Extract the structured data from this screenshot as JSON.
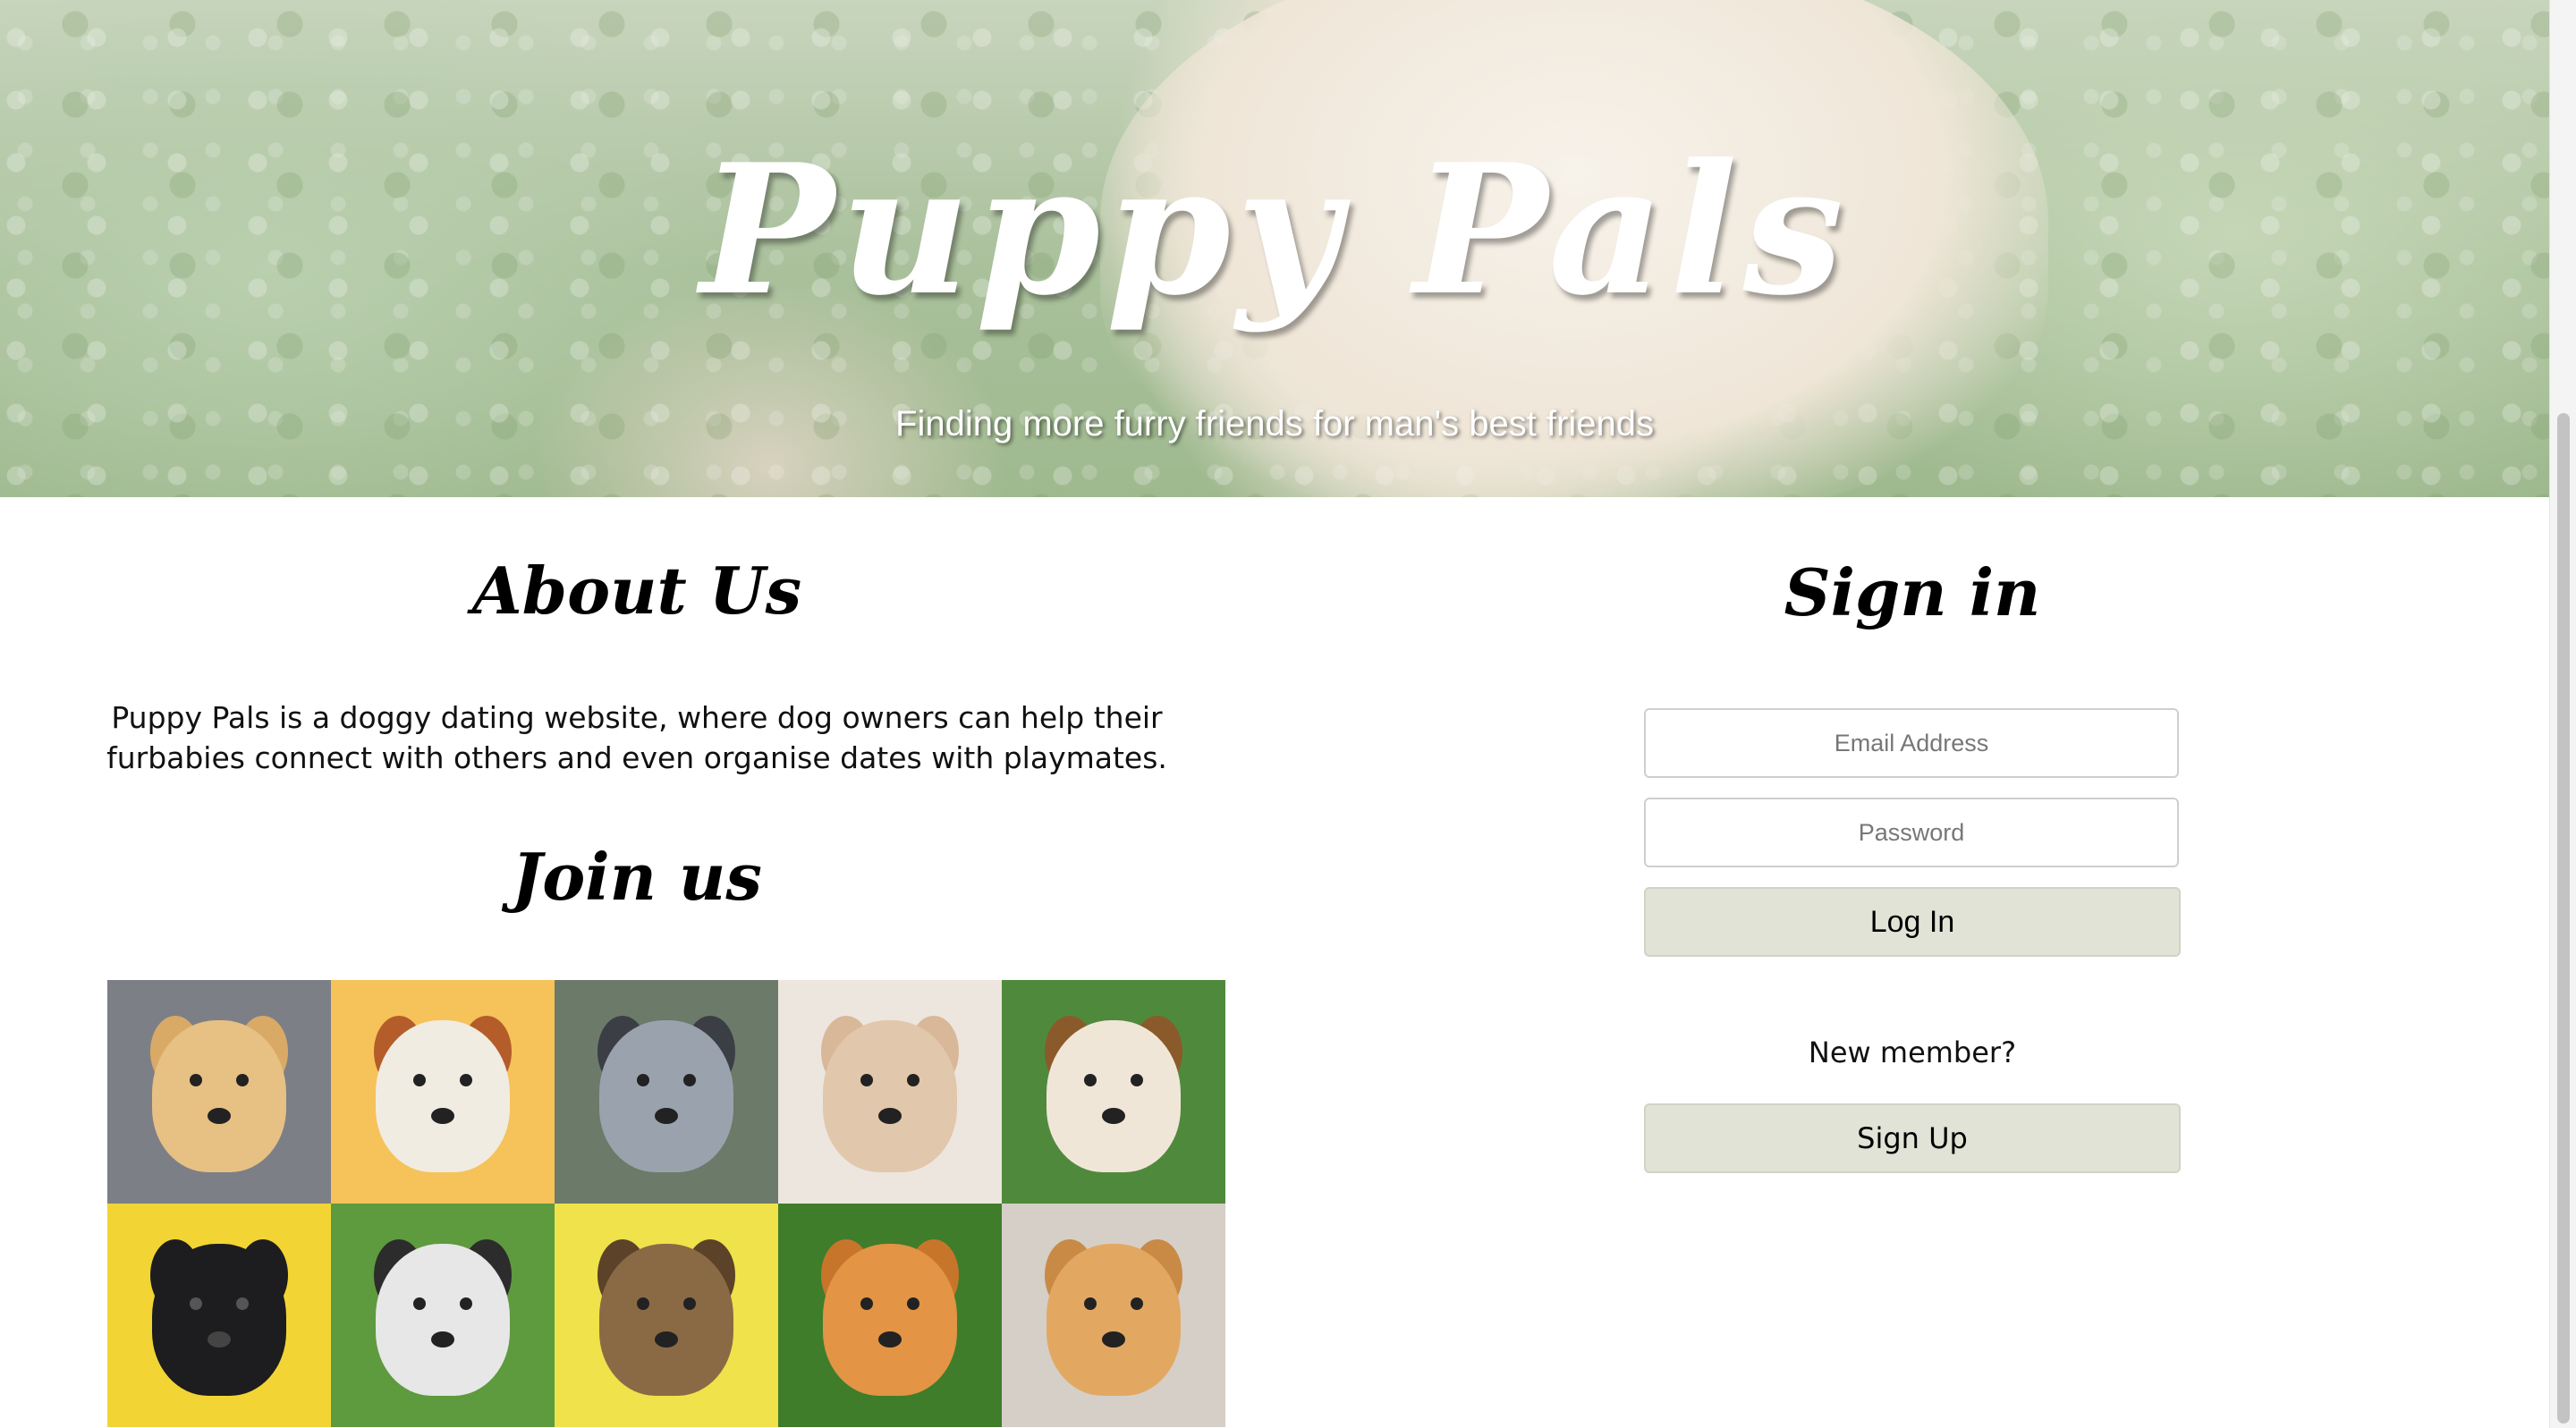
{
  "hero": {
    "title": "Puppy Pals",
    "subtitle": "Finding more furry friends for man's best friends"
  },
  "about": {
    "title": "About Us",
    "text": "Puppy Pals is a doggy dating website, where dog owners can help their furbabies connect with others and even organise dates with playmates."
  },
  "join": {
    "title": "Join us"
  },
  "gallery": {
    "tiles": [
      {
        "icon": "golden-retriever-puppy-photo",
        "bg": "#7d7f86",
        "coat": "#e7c084",
        "ear": "#d9aa66"
      },
      {
        "icon": "cavalier-spaniel-photo",
        "bg": "#f6c25a",
        "coat": "#f1ece2",
        "ear": "#b45d2a"
      },
      {
        "icon": "australian-shepherd-photo",
        "bg": "#6c7a6a",
        "coat": "#9aa3ad",
        "ear": "#3b3f45"
      },
      {
        "icon": "french-bulldog-photo",
        "bg": "#ece6df",
        "coat": "#e1c7ab",
        "ear": "#d8b898"
      },
      {
        "icon": "beagle-photo",
        "bg": "#4f8a3c",
        "coat": "#f0e6d8",
        "ear": "#8b5a2b"
      },
      {
        "icon": "black-french-bulldog-photo",
        "bg": "#f2d534",
        "coat": "#1d1d1f",
        "ear": "#1d1d1f"
      },
      {
        "icon": "husky-puppy-photo",
        "bg": "#5e9a3e",
        "coat": "#e7e7e7",
        "ear": "#2c2c2c"
      },
      {
        "icon": "smiling-dog-photo",
        "bg": "#efe24a",
        "coat": "#8a6a45",
        "ear": "#5c4228"
      },
      {
        "icon": "pomeranian-photo",
        "bg": "#3f7d2a",
        "coat": "#e39445",
        "ear": "#c8752c"
      },
      {
        "icon": "shiba-inu-photo",
        "bg": "#d5cfc8",
        "coat": "#e2a862",
        "ear": "#c98a45"
      }
    ]
  },
  "signin": {
    "title": "Sign in",
    "email_placeholder": "Email Address",
    "password_placeholder": "Password",
    "login_label": "Log In",
    "new_member_text": "New member?",
    "signup_label": "Sign Up"
  },
  "colors": {
    "button_bg": "#e1e3d6",
    "hero_text": "#ffffff"
  }
}
